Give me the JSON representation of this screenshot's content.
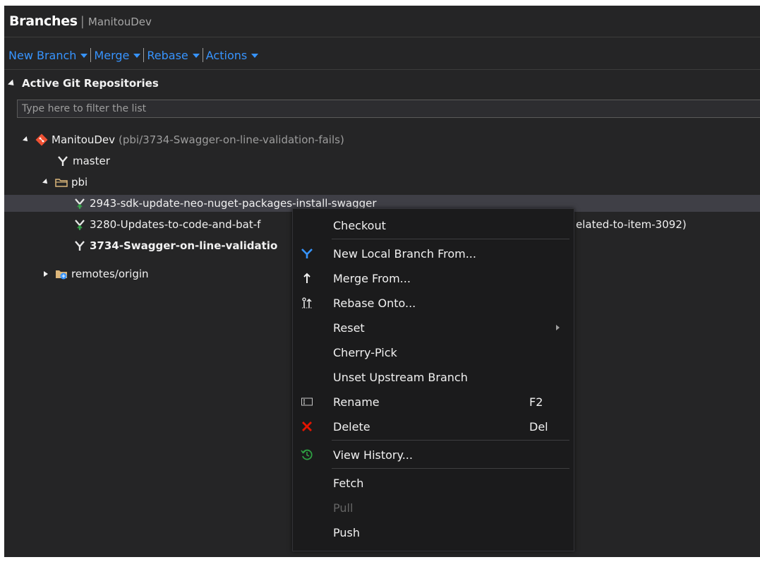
{
  "header": {
    "title": "Branches",
    "separator": "|",
    "subtitle": "ManitouDev"
  },
  "toolbar": {
    "items": [
      {
        "label": "New Branch"
      },
      {
        "label": "Merge"
      },
      {
        "label": "Rebase"
      },
      {
        "label": "Actions"
      }
    ],
    "accent_color": "#3794ff"
  },
  "section": {
    "label": "Active Git Repositories"
  },
  "filter": {
    "placeholder": "Type here to filter the list",
    "value": ""
  },
  "tree": {
    "repo": {
      "name": "ManitouDev",
      "current_branch": "(pbi/3734-Swagger-on-line-validation-fails)",
      "icon": "git-diamond-icon"
    },
    "master": {
      "label": "master",
      "icon": "branch-icon"
    },
    "folder": {
      "label": "pbi",
      "icon": "folder-icon"
    },
    "branches": [
      {
        "label": "2943-sdk-update-neo-nuget-packages-install-swagger",
        "icon": "published-branch-icon",
        "selected": true
      },
      {
        "label": "3280-Updates-to-code-and-bat-f",
        "tail": "elated-to-item-3092)",
        "icon": "published-branch-icon"
      },
      {
        "label": "3734-Swagger-on-line-validatio",
        "icon": "branch-icon",
        "bold": true
      }
    ],
    "remotes": {
      "label": "remotes/origin",
      "icon": "remote-folder-icon"
    }
  },
  "context_menu": {
    "items": [
      {
        "label": "Checkout"
      },
      {
        "label": "New Local Branch From...",
        "icon": "new-branch-icon"
      },
      {
        "label": "Merge From...",
        "icon": "merge-icon"
      },
      {
        "label": "Rebase Onto...",
        "icon": "rebase-icon"
      },
      {
        "label": "Reset",
        "submenu": true
      },
      {
        "label": "Cherry-Pick"
      },
      {
        "label": "Unset Upstream Branch"
      },
      {
        "label": "Rename",
        "shortcut": "F2",
        "icon": "rename-icon"
      },
      {
        "label": "Delete",
        "shortcut": "Del",
        "icon": "delete-icon"
      },
      {
        "label": "View History...",
        "icon": "history-icon"
      },
      {
        "label": "Fetch"
      },
      {
        "label": "Pull",
        "disabled": true
      },
      {
        "label": "Push"
      }
    ]
  },
  "colors": {
    "background": "#252526",
    "menu_background": "#1b1b1c",
    "selection": "#3f3f46",
    "link": "#3794ff",
    "delete_red": "#e51400",
    "history_green": "#2ea043"
  }
}
